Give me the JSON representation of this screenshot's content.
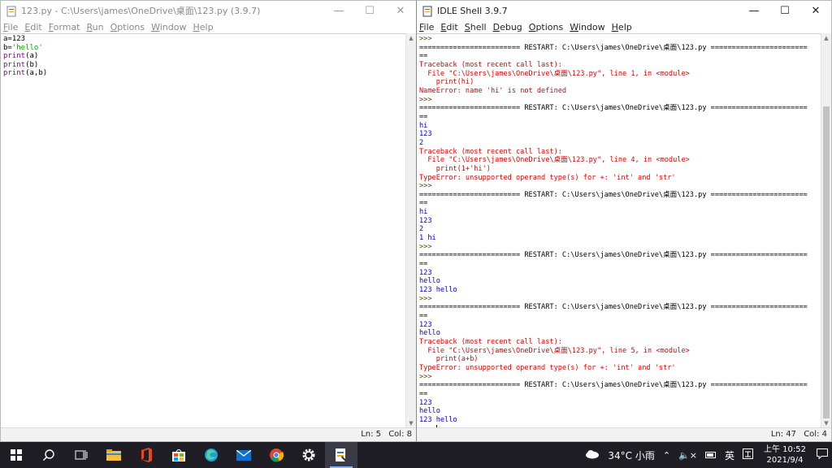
{
  "editor": {
    "title": "123.py - C:\\Users\\james\\OneDrive\\桌面\\123.py (3.9.7)",
    "menu": [
      "File",
      "Edit",
      "Format",
      "Run",
      "Options",
      "Window",
      "Help"
    ],
    "code": [
      [
        {
          "t": "a=123",
          "c": "plain"
        }
      ],
      [
        {
          "t": "b=",
          "c": "plain"
        },
        {
          "t": "'hello'",
          "c": "str"
        }
      ],
      [
        {
          "t": "print",
          "c": "kw"
        },
        {
          "t": "(a)",
          "c": "plain"
        }
      ],
      [
        {
          "t": "print",
          "c": "kw"
        },
        {
          "t": "(b)",
          "c": "plain"
        }
      ],
      [
        {
          "t": "print",
          "c": "kw"
        },
        {
          "t": "(a,b)",
          "c": "plain"
        }
      ]
    ],
    "status": {
      "ln": "Ln: 5",
      "col": "Col: 8"
    }
  },
  "shell": {
    "title": "IDLE Shell 3.9.7",
    "menu": [
      "File",
      "Edit",
      "Shell",
      "Debug",
      "Options",
      "Window",
      "Help"
    ],
    "lines": [
      {
        "t": ">>> ",
        "c": "prompt"
      },
      {
        "t": "======================== RESTART: C:\\Users\\james\\OneDrive\\桌面\\123.py =======================",
        "c": "sep"
      },
      {
        "t": "==",
        "c": "sep"
      },
      {
        "t": "Traceback (most recent call last):",
        "c": "err"
      },
      {
        "t": "  File \"C:\\Users\\james\\OneDrive\\桌面\\123.py\", line 1, in <module>",
        "c": "err"
      },
      {
        "t": "    print(hi)",
        "c": "err"
      },
      {
        "t": "NameError: name 'hi' is not defined",
        "c": "err"
      },
      {
        "t": ">>> ",
        "c": "prompt"
      },
      {
        "t": "======================== RESTART: C:\\Users\\james\\OneDrive\\桌面\\123.py =======================",
        "c": "sep"
      },
      {
        "t": "==",
        "c": "sep"
      },
      {
        "t": "hi",
        "c": "out"
      },
      {
        "t": "123",
        "c": "out"
      },
      {
        "t": "2",
        "c": "out"
      },
      {
        "t": "Traceback (most recent call last):",
        "c": "err"
      },
      {
        "t": "  File \"C:\\Users\\james\\OneDrive\\桌面\\123.py\", line 4, in <module>",
        "c": "err"
      },
      {
        "t": "    print(1+'hi')",
        "c": "err"
      },
      {
        "t": "TypeError: unsupported operand type(s) for +: 'int' and 'str'",
        "c": "err"
      },
      {
        "t": ">>> ",
        "c": "prompt"
      },
      {
        "t": "======================== RESTART: C:\\Users\\james\\OneDrive\\桌面\\123.py =======================",
        "c": "sep"
      },
      {
        "t": "==",
        "c": "sep"
      },
      {
        "t": "hi",
        "c": "out"
      },
      {
        "t": "123",
        "c": "out"
      },
      {
        "t": "2",
        "c": "out"
      },
      {
        "t": "1 hi",
        "c": "out"
      },
      {
        "t": ">>> ",
        "c": "prompt"
      },
      {
        "t": "======================== RESTART: C:\\Users\\james\\OneDrive\\桌面\\123.py =======================",
        "c": "sep"
      },
      {
        "t": "==",
        "c": "sep"
      },
      {
        "t": "123",
        "c": "out"
      },
      {
        "t": "hello",
        "c": "out"
      },
      {
        "t": "123 hello",
        "c": "out"
      },
      {
        "t": ">>> ",
        "c": "prompt"
      },
      {
        "t": "======================== RESTART: C:\\Users\\james\\OneDrive\\桌面\\123.py =======================",
        "c": "sep"
      },
      {
        "t": "==",
        "c": "sep"
      },
      {
        "t": "123",
        "c": "out"
      },
      {
        "t": "hello",
        "c": "out"
      },
      {
        "t": "Traceback (most recent call last):",
        "c": "err"
      },
      {
        "t": "  File \"C:\\Users\\james\\OneDrive\\桌面\\123.py\", line 5, in <module>",
        "c": "err"
      },
      {
        "t": "    print(a+b)",
        "c": "err"
      },
      {
        "t": "TypeError: unsupported operand type(s) for +: 'int' and 'str'",
        "c": "err"
      },
      {
        "t": ">>> ",
        "c": "prompt"
      },
      {
        "t": "======================== RESTART: C:\\Users\\james\\OneDrive\\桌面\\123.py =======================",
        "c": "sep"
      },
      {
        "t": "==",
        "c": "sep"
      },
      {
        "t": "123",
        "c": "out"
      },
      {
        "t": "hello",
        "c": "out"
      },
      {
        "t": "123 hello",
        "c": "out"
      },
      {
        "t": ">>> ",
        "c": "prompt",
        "cursor": true
      }
    ],
    "status": {
      "ln": "Ln: 47",
      "col": "Col: 4"
    }
  },
  "taskbar": {
    "apps": [
      "windows-start-icon",
      "search-icon",
      "task-view-icon",
      "file-explorer-icon",
      "office-icon",
      "store-icon",
      "edge-icon",
      "mail-icon",
      "chrome-icon",
      "settings-icon",
      "idle-icon"
    ],
    "weather": "34°C 小雨",
    "ime": "英",
    "time": "上午 10:52",
    "date": "2021/9/4"
  }
}
